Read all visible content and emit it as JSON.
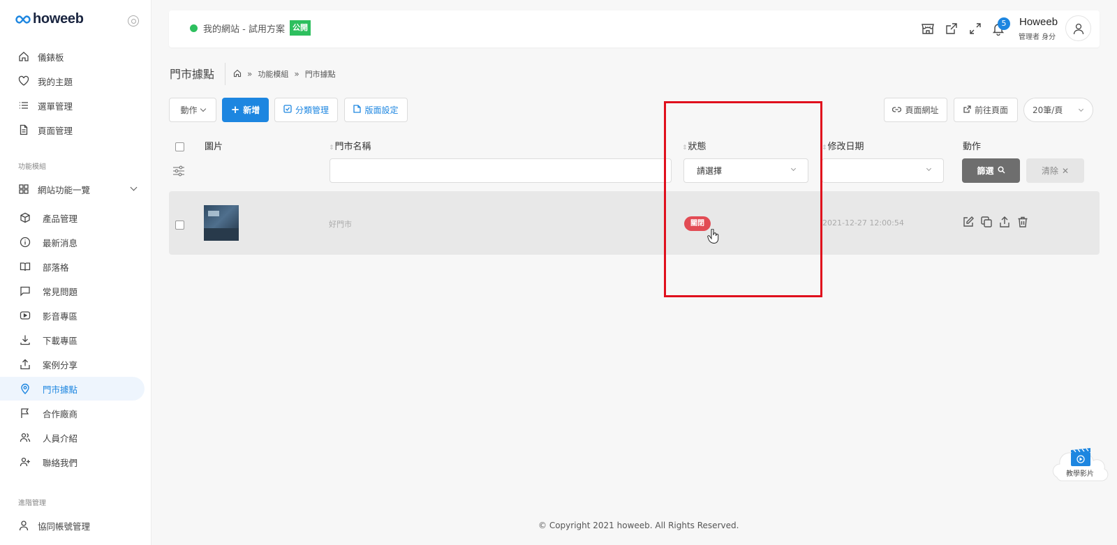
{
  "logo": {
    "text": "howeeb"
  },
  "sidebar": {
    "top_items": [
      {
        "label": "儀錶板",
        "icon": "home-icon"
      },
      {
        "label": "我的主題",
        "icon": "heart-icon"
      },
      {
        "label": "選單管理",
        "icon": "list-icon"
      },
      {
        "label": "頁面管理",
        "icon": "document-icon"
      }
    ],
    "group_modules": "功能模組",
    "site_features": "網站功能一覽",
    "sub_items": [
      {
        "label": "產品管理",
        "icon": "box-icon"
      },
      {
        "label": "最新消息",
        "icon": "info-icon"
      },
      {
        "label": "部落格",
        "icon": "book-icon"
      },
      {
        "label": "常見問題",
        "icon": "chat-icon"
      },
      {
        "label": "影音專區",
        "icon": "video-icon"
      },
      {
        "label": "下載專區",
        "icon": "download-icon"
      },
      {
        "label": "案例分享",
        "icon": "share-icon"
      },
      {
        "label": "門市據點",
        "icon": "location-icon"
      },
      {
        "label": "合作廠商",
        "icon": "flag-icon"
      },
      {
        "label": "人員介紹",
        "icon": "users-icon"
      },
      {
        "label": "聯絡我們",
        "icon": "user-plus-icon"
      }
    ],
    "group_advanced": "進階管理",
    "advanced_items": [
      {
        "label": "協同帳號管理",
        "icon": "user-icon"
      }
    ]
  },
  "header": {
    "site_name": "我的網站 - 試用方案",
    "public_badge": "公開",
    "notification_count": "5",
    "user_name": "Howeeb",
    "user_role": "管理者 身分"
  },
  "page": {
    "title": "門市據點",
    "breadcrumb": [
      "功能模組",
      "門市據點"
    ]
  },
  "toolbar": {
    "action_label": "動作",
    "new_label": "新增",
    "category_label": "分類管理",
    "layout_label": "版面設定",
    "page_url_label": "頁面網址",
    "goto_page_label": "前往頁面",
    "per_page": "20筆/頁"
  },
  "table": {
    "columns": [
      "圖片",
      "門市名稱",
      "狀態",
      "修改日期",
      "動作"
    ],
    "status_placeholder": "請選擇",
    "filter_label": "篩選",
    "clear_label": "清除",
    "rows": [
      {
        "name": "好門市",
        "status": "關閉",
        "modified": "2021-12-27 12:00:54"
      }
    ]
  },
  "footer": {
    "copyright": "© Copyright 2021 howeeb. All Rights Reserved."
  },
  "tutorial": {
    "label": "教學影片"
  },
  "colors": {
    "accent": "#1d86e0",
    "success": "#2dbf5e",
    "danger": "#e24b54",
    "highlight": "#e0101d"
  }
}
